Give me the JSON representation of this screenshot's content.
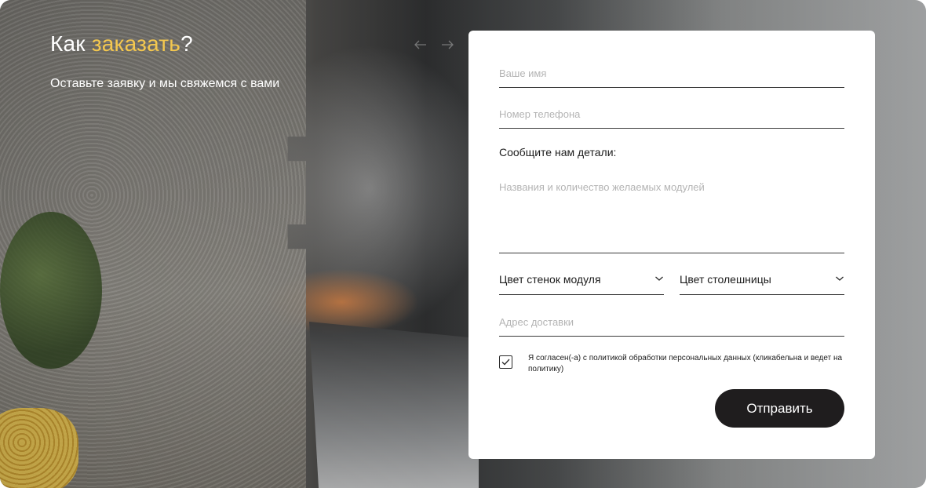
{
  "hero": {
    "title_prefix": "Как ",
    "title_accent": "заказать",
    "title_suffix": "?",
    "subtitle": "Оставьте заявку и мы свяжемся с вами",
    "accent_color": "#f3c74f"
  },
  "form": {
    "name_placeholder": "Ваше имя",
    "phone_placeholder": "Номер телефона",
    "details_label": "Сообщите нам детали:",
    "details_placeholder": "Названия и количество желаемых модулей",
    "walls_color_label": "Цвет стенок модуля",
    "countertop_color_label": "Цвет столешницы",
    "address_placeholder": "Адрес доставки",
    "consent_checked": true,
    "consent_text": "Я согласен(-а) с политикой обработки персональных данных (кликабельна и ведет на политику)",
    "submit_label": "Отправить",
    "button_color": "#1f1d1e"
  }
}
